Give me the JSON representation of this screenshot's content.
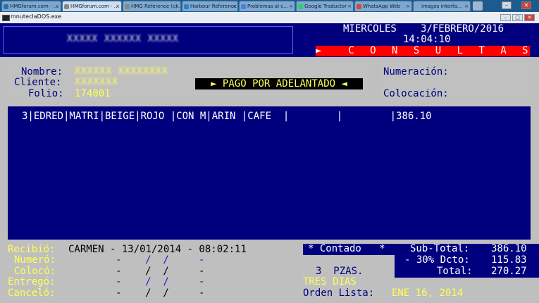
{
  "browser": {
    "tabs": [
      {
        "label": "HMGforum.com - ...",
        "active": false,
        "color": "#2a6fb0"
      },
      {
        "label": "HMGforum.com - ...",
        "active": true,
        "color": "#2a6fb0"
      },
      {
        "label": "HMG Reference (c)...",
        "active": false,
        "color": "#888888"
      },
      {
        "label": "Harbour Reference ...",
        "active": false,
        "color": "#888888"
      },
      {
        "label": "Problemas al c...",
        "active": false,
        "color": "#2f7fd0"
      },
      {
        "label": "Google Traductor",
        "active": false,
        "color": "#4a7fe0"
      },
      {
        "label": "WhatsApp Web",
        "active": false,
        "color": "#25d366"
      },
      {
        "label": "images interfa...",
        "active": false,
        "color": "#dd4433"
      }
    ],
    "window_buttons": {
      "minimize": "–",
      "close": "✕"
    }
  },
  "console_window": {
    "title": "mnutecIaDOS.exe",
    "buttons": {
      "minimize": "–",
      "maximize": "□",
      "close": "✕"
    }
  },
  "header": {
    "company_blurred": "XXXXX XXXXXX XXXXX",
    "day": "MIERCOLES",
    "date": "3/FEBRERO/2016",
    "time": "14:04:10",
    "mode_label": "►  C O N S U L T A S  ◄"
  },
  "customer": {
    "nombre_label": "Nombre:",
    "nombre_value": "XXXXXX XXXXXXXX",
    "cliente_label": "Cliente:",
    "cliente_value": "XXXXXXX",
    "folio_label": "Folio:",
    "folio_value": "174001",
    "payment_badge": "► PAGO POR ADELANTADO ◄",
    "numeracion_label": "Numeración:",
    "colocacion_label": "Colocación:"
  },
  "detail": {
    "rows": [
      "3|EDRED|MATRI|BEIGE|ROJO |CON M|ARIN |CAFE  |        |        |386.10"
    ]
  },
  "footer": {
    "recibio_label": "Recibió:",
    "recibio_value": "CARMEN - 13/01/2014 - 08:02:11",
    "numero_label": "Numeró:",
    "numero_value": "-    /  /     -",
    "coloco_label": "Colocó:",
    "coloco_value": "-    /  /     -",
    "entrego_label": "Entregó:",
    "entrego_value": "-    /  /     -",
    "cancelo_label": "Canceló:",
    "cancelo_value": "-    /  /     -",
    "payment_type": "* Contado   *",
    "pieces": "3  PZAS.",
    "delivery": "TRES DIAS",
    "orden_label": "Orden Lista:",
    "orden_value": "ENE 16, 2014",
    "subtotal_label": "Sub-Total:",
    "subtotal_value": "386.10",
    "discount_label": "- 30% Dcto:",
    "discount_value": "115.83",
    "total_label": "Total:",
    "total_value": "270.27"
  }
}
